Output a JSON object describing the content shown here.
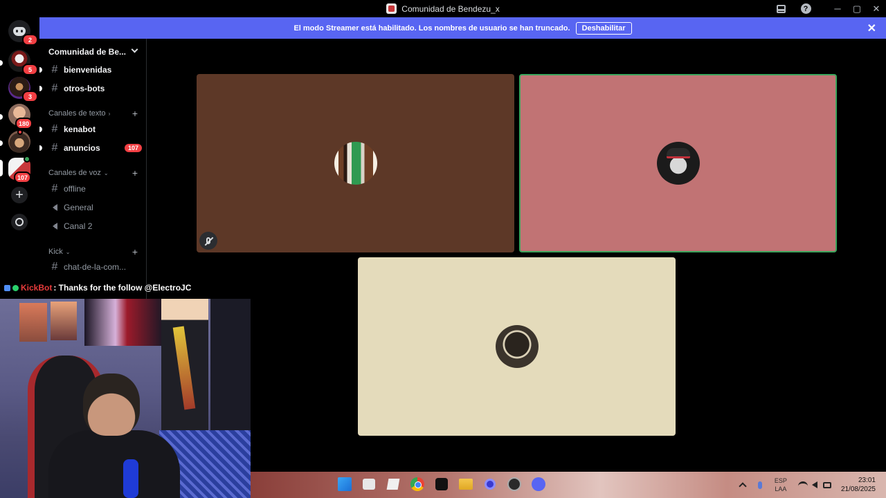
{
  "window": {
    "title": "Comunidad de Bendezu_x"
  },
  "server_rail": {
    "badges": [
      "2",
      "5",
      "3",
      "180",
      "107"
    ]
  },
  "streamer_banner": {
    "message": "El modo Streamer está habilitado. Los nombres de usuario se han truncado.",
    "disable_label": "Deshabilitar",
    "close_label": "✕"
  },
  "sidebar": {
    "guild_name": "Comunidad de Be...",
    "channels_top": [
      {
        "name": "bienvenidas"
      },
      {
        "name": "otros-bots"
      }
    ],
    "text_category": "Canales de texto",
    "text_channels": [
      {
        "name": "kenabot",
        "badge": ""
      },
      {
        "name": "anuncios",
        "badge": "107"
      }
    ],
    "voice_category": "Canales de voz",
    "voice_channels": [
      {
        "name": "offline",
        "kind": "text"
      },
      {
        "name": "General",
        "kind": "voice"
      },
      {
        "name": "Canal 2",
        "kind": "voice"
      }
    ],
    "kick_category": "Kick",
    "kick_channels": [
      {
        "name": "chat-de-la-com..."
      }
    ]
  },
  "voice_tiles": {
    "count": 3,
    "speaking_tile": 2,
    "muted_tile": 1
  },
  "chat_overlay": {
    "user": "KickBot",
    "message": ": Thanks for the follow @ElectroJC"
  },
  "taskbar": {
    "lang_top": "ESP",
    "lang_bottom": "LAA",
    "time": "23:01",
    "date": "21/08/2025"
  },
  "colors": {
    "banner": "#5865f2",
    "badge": "#f23f43",
    "speaking_border": "#3ba55c",
    "tile_1": "#5d3827",
    "tile_2": "#c17374",
    "tile_3": "#e4dbbb"
  }
}
